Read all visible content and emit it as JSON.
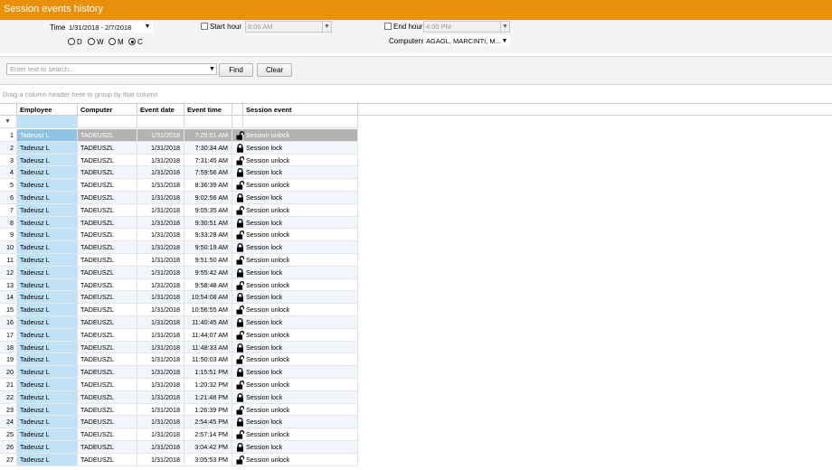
{
  "title": "Session events history",
  "filters": {
    "time_label": "Time",
    "time_value": "1/31/2018 - 2/7/2018",
    "start_hour_label": "Start hour",
    "start_hour_value": "8:00 AM",
    "end_hour_label": "End hour",
    "end_hour_value": "4:00 PM",
    "computers_label": "Computers",
    "computers_value": "AGAGL, MARCINTI, M...",
    "period_options": [
      "D",
      "W",
      "M",
      "C"
    ],
    "period_selected": "C"
  },
  "search": {
    "placeholder": "Enter text to search...",
    "find_label": "Find",
    "clear_label": "Clear"
  },
  "group_hint": "Drag a column header here to group by that column",
  "columns": [
    "Employee",
    "Computer",
    "Event date",
    "Event time",
    "",
    "Session event"
  ],
  "rows": [
    {
      "n": "1",
      "employee": "Tadeusz L",
      "computer": "TADEUSZL",
      "date": "1/31/2018",
      "time": "7:25:51 AM",
      "event": "Session unlock",
      "icon": "unlock-icon"
    },
    {
      "n": "2",
      "employee": "Tadeusz L",
      "computer": "TADEUSZL",
      "date": "1/31/2018",
      "time": "7:30:34 AM",
      "event": "Session lock",
      "icon": "lock-icon"
    },
    {
      "n": "3",
      "employee": "Tadeusz L",
      "computer": "TADEUSZL",
      "date": "1/31/2018",
      "time": "7:31:45 AM",
      "event": "Session unlock",
      "icon": "unlock-icon"
    },
    {
      "n": "4",
      "employee": "Tadeusz L",
      "computer": "TADEUSZL",
      "date": "1/31/2018",
      "time": "7:59:56 AM",
      "event": "Session lock",
      "icon": "lock-icon"
    },
    {
      "n": "5",
      "employee": "Tadeusz L",
      "computer": "TADEUSZL",
      "date": "1/31/2018",
      "time": "8:36:39 AM",
      "event": "Session unlock",
      "icon": "unlock-icon"
    },
    {
      "n": "6",
      "employee": "Tadeusz L",
      "computer": "TADEUSZL",
      "date": "1/31/2018",
      "time": "9:02:56 AM",
      "event": "Session lock",
      "icon": "lock-icon"
    },
    {
      "n": "7",
      "employee": "Tadeusz L",
      "computer": "TADEUSZL",
      "date": "1/31/2018",
      "time": "9:05:35 AM",
      "event": "Session unlock",
      "icon": "unlock-icon"
    },
    {
      "n": "8",
      "employee": "Tadeusz L",
      "computer": "TADEUSZL",
      "date": "1/31/2018",
      "time": "9:30:51 AM",
      "event": "Session lock",
      "icon": "lock-icon"
    },
    {
      "n": "9",
      "employee": "Tadeusz L",
      "computer": "TADEUSZL",
      "date": "1/31/2018",
      "time": "9:33:28 AM",
      "event": "Session unlock",
      "icon": "unlock-icon"
    },
    {
      "n": "10",
      "employee": "Tadeusz L",
      "computer": "TADEUSZL",
      "date": "1/31/2018",
      "time": "9:50:19 AM",
      "event": "Session lock",
      "icon": "lock-icon"
    },
    {
      "n": "11",
      "employee": "Tadeusz L",
      "computer": "TADEUSZL",
      "date": "1/31/2018",
      "time": "9:51:50 AM",
      "event": "Session unlock",
      "icon": "unlock-icon"
    },
    {
      "n": "12",
      "employee": "Tadeusz L",
      "computer": "TADEUSZL",
      "date": "1/31/2018",
      "time": "9:55:42 AM",
      "event": "Session lock",
      "icon": "lock-icon"
    },
    {
      "n": "13",
      "employee": "Tadeusz L",
      "computer": "TADEUSZL",
      "date": "1/31/2018",
      "time": "9:58:48 AM",
      "event": "Session unlock",
      "icon": "unlock-icon"
    },
    {
      "n": "14",
      "employee": "Tadeusz L",
      "computer": "TADEUSZL",
      "date": "1/31/2018",
      "time": "10:54:08 AM",
      "event": "Session lock",
      "icon": "lock-icon"
    },
    {
      "n": "15",
      "employee": "Tadeusz L",
      "computer": "TADEUSZL",
      "date": "1/31/2018",
      "time": "10:56:55 AM",
      "event": "Session unlock",
      "icon": "unlock-icon"
    },
    {
      "n": "16",
      "employee": "Tadeusz L",
      "computer": "TADEUSZL",
      "date": "1/31/2018",
      "time": "11:40:45 AM",
      "event": "Session lock",
      "icon": "lock-icon"
    },
    {
      "n": "17",
      "employee": "Tadeusz L",
      "computer": "TADEUSZL",
      "date": "1/31/2018",
      "time": "11:44:07 AM",
      "event": "Session unlock",
      "icon": "unlock-icon"
    },
    {
      "n": "18",
      "employee": "Tadeusz L",
      "computer": "TADEUSZL",
      "date": "1/31/2018",
      "time": "11:48:33 AM",
      "event": "Session lock",
      "icon": "lock-icon"
    },
    {
      "n": "19",
      "employee": "Tadeusz L",
      "computer": "TADEUSZL",
      "date": "1/31/2018",
      "time": "11:50:03 AM",
      "event": "Session unlock",
      "icon": "unlock-icon"
    },
    {
      "n": "20",
      "employee": "Tadeusz L",
      "computer": "TADEUSZL",
      "date": "1/31/2018",
      "time": "1:15:51 PM",
      "event": "Session lock",
      "icon": "lock-icon"
    },
    {
      "n": "21",
      "employee": "Tadeusz L",
      "computer": "TADEUSZL",
      "date": "1/31/2018",
      "time": "1:20:32 PM",
      "event": "Session unlock",
      "icon": "unlock-icon"
    },
    {
      "n": "22",
      "employee": "Tadeusz L",
      "computer": "TADEUSZL",
      "date": "1/31/2018",
      "time": "1:21:48 PM",
      "event": "Session lock",
      "icon": "lock-icon"
    },
    {
      "n": "23",
      "employee": "Tadeusz L",
      "computer": "TADEUSZL",
      "date": "1/31/2018",
      "time": "1:26:39 PM",
      "event": "Session unlock",
      "icon": "unlock-icon"
    },
    {
      "n": "24",
      "employee": "Tadeusz L",
      "computer": "TADEUSZL",
      "date": "1/31/2018",
      "time": "2:54:45 PM",
      "event": "Session lock",
      "icon": "lock-icon"
    },
    {
      "n": "25",
      "employee": "Tadeusz L",
      "computer": "TADEUSZL",
      "date": "1/31/2018",
      "time": "2:57:14 PM",
      "event": "Session unlock",
      "icon": "unlock-icon"
    },
    {
      "n": "26",
      "employee": "Tadeusz L",
      "computer": "TADEUSZL",
      "date": "1/31/2018",
      "time": "3:04:42 PM",
      "event": "Session lock",
      "icon": "lock-icon"
    },
    {
      "n": "27",
      "employee": "Tadeusz L",
      "computer": "TADEUSZL",
      "date": "1/31/2018",
      "time": "3:05:53 PM",
      "event": "Session unlock",
      "icon": "unlock-icon"
    }
  ],
  "selected_row": "1"
}
